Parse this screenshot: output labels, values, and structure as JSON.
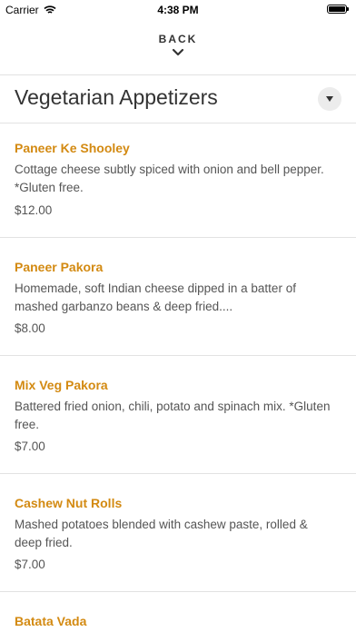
{
  "status_bar": {
    "carrier": "Carrier",
    "time": "4:38 PM"
  },
  "nav": {
    "back_label": "BACK"
  },
  "section": {
    "title": "Vegetarian Appetizers"
  },
  "items": [
    {
      "name": "Paneer Ke Shooley",
      "description": "Cottage cheese subtly spiced with onion and bell pepper. *Gluten free.",
      "price": "$12.00"
    },
    {
      "name": "Paneer Pakora",
      "description": "Homemade, soft Indian cheese dipped in a batter of mashed garbanzo beans & deep fried....",
      "price": "$8.00"
    },
    {
      "name": "Mix Veg Pakora",
      "description": "Battered fried onion, chili, potato and spinach mix. *Gluten free.",
      "price": "$7.00"
    },
    {
      "name": "Cashew Nut Rolls",
      "description": "Mashed potatoes blended with cashew paste, rolled & deep fried.",
      "price": "$7.00"
    },
    {
      "name": "Batata Vada"
    }
  ],
  "icons": {
    "wifi": "wifi-icon",
    "battery": "battery-icon",
    "back": "chevron-down-icon",
    "dropdown": "caret-down-icon"
  },
  "colors": {
    "item_name": "#d38a12",
    "divider": "#e2e2e2"
  }
}
